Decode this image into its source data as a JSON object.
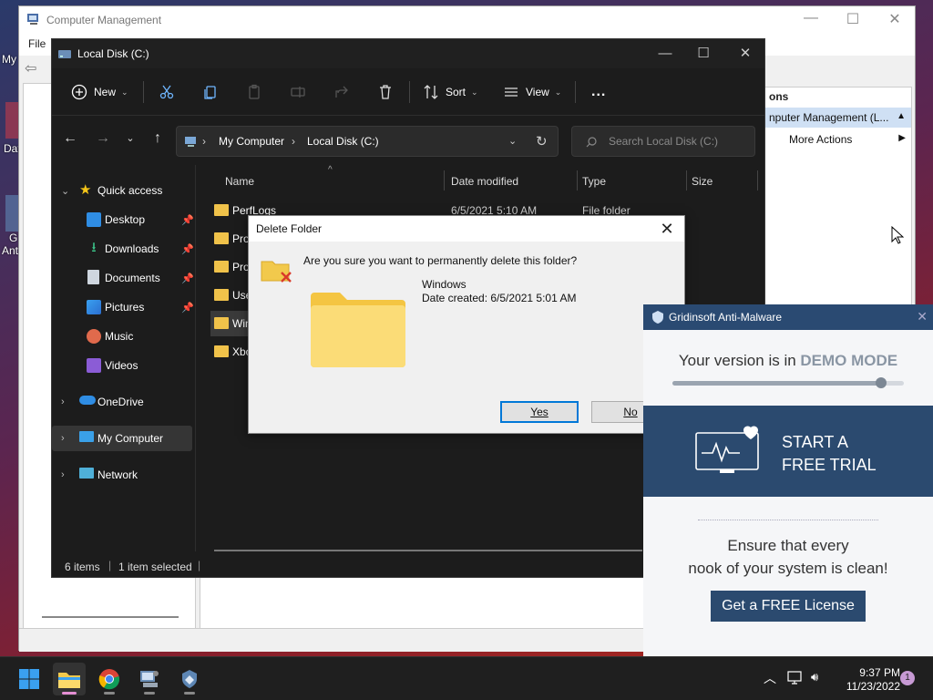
{
  "desktop": {
    "labels": [
      "My",
      "Dat",
      "G",
      "Ant"
    ]
  },
  "computer_management": {
    "title": "Computer Management",
    "menu_file": "File",
    "actions_header": "ons",
    "actions_item_1": "nputer Management (L...",
    "actions_item_2": "More Actions"
  },
  "explorer": {
    "title": "Local Disk (C:)",
    "toolbar": {
      "new_label": "New",
      "sort_label": "Sort",
      "view_label": "View",
      "more_label": "..."
    },
    "address": {
      "segments": [
        "My Computer",
        "Local Disk (C:)"
      ]
    },
    "search": {
      "placeholder": "Search Local Disk (C:)"
    },
    "nav": {
      "quick_access": "Quick access",
      "desktop": "Desktop",
      "downloads": "Downloads",
      "documents": "Documents",
      "pictures": "Pictures",
      "music": "Music",
      "videos": "Videos",
      "onedrive": "OneDrive",
      "my_computer": "My Computer",
      "network": "Network"
    },
    "columns": {
      "name": "Name",
      "date_modified": "Date modified",
      "type": "Type",
      "size": "Size"
    },
    "files": [
      {
        "name": "PerfLogs",
        "date": "6/5/2021 5:10 AM",
        "type": "File folder"
      },
      {
        "name": "Pro",
        "date": "",
        "type": ""
      },
      {
        "name": "Pro",
        "date": "",
        "type": ""
      },
      {
        "name": "Use",
        "date": "",
        "type": ""
      },
      {
        "name": "Win",
        "date": "",
        "type": ""
      },
      {
        "name": "Xbo",
        "date": "",
        "type": ""
      }
    ],
    "status": {
      "items": "6 items",
      "selected": "1 item selected"
    }
  },
  "dialog": {
    "title": "Delete Folder",
    "question": "Are you sure you want to permanently delete this folder?",
    "folder_name": "Windows",
    "date_created": "Date created: 6/5/2021 5:01 AM",
    "yes_label": "Yes",
    "no_label": "No"
  },
  "gridinsoft": {
    "title": "Gridinsoft Anti-Malware",
    "mode_prefix": "Your version is in ",
    "mode_value": "DEMO MODE",
    "slider_fraction": 0.9,
    "trial_line1": "START A",
    "trial_line2": "FREE TRIAL",
    "copy_line1": "Ensure that every",
    "copy_line2": "nook of your system is clean!",
    "license_button": "Get a FREE License",
    "accent_color": "#2b4a6f"
  },
  "taskbar": {
    "apps": [
      "start-icon",
      "file-explorer-icon",
      "chrome-icon",
      "computer-management-icon",
      "gridinsoft-icon"
    ],
    "time": "9:37 PM",
    "date": "11/23/2022",
    "notification_count": "1"
  }
}
